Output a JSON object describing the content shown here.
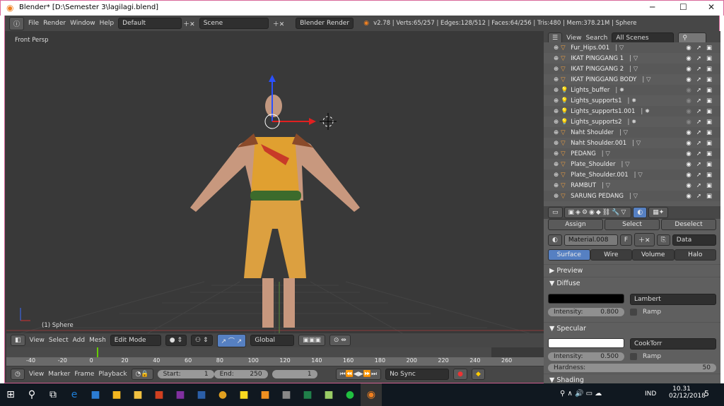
{
  "window": {
    "title": "Blender* [D:\\Semester 3\\lagilagi.blend]",
    "minimize": "─",
    "maximize": "☐",
    "close": "✕"
  },
  "info_header": {
    "menus": [
      "File",
      "Render",
      "Window",
      "Help"
    ],
    "layout": "Default",
    "scene": "Scene",
    "engine": "Blender Render",
    "stats": "v2.78 | Verts:65/257 | Edges:128/512 | Faces:64/256 | Tris:480 | Mem:378.21M | Sphere"
  },
  "viewport": {
    "view_label": "Front Persp",
    "object_label": "(1) Sphere"
  },
  "view3d_header": {
    "menus": [
      "View",
      "Select",
      "Add",
      "Mesh"
    ],
    "mode": "Edit Mode",
    "orientation": "Global"
  },
  "timeline": {
    "ruler": [
      "-40",
      "-20",
      "0",
      "20",
      "40",
      "60",
      "80",
      "100",
      "120",
      "140",
      "160",
      "180",
      "200",
      "220",
      "240",
      "260"
    ],
    "menus": [
      "View",
      "Marker",
      "Frame",
      "Playback"
    ],
    "start_label": "Start:",
    "start": "1",
    "end_label": "End:",
    "end": "250",
    "current": "1",
    "sync": "No Sync"
  },
  "outliner": {
    "menus": [
      "View",
      "Search"
    ],
    "filter": "All Scenes",
    "items": [
      {
        "name": "Fur_Hips.001",
        "type": "mesh"
      },
      {
        "name": "IKAT PINGGANG 1",
        "type": "mesh"
      },
      {
        "name": "IKAT PINGGANG 2",
        "type": "mesh"
      },
      {
        "name": "IKAT PINGGANG BODY",
        "type": "mesh"
      },
      {
        "name": "Lights_buffer",
        "type": "light"
      },
      {
        "name": "Lights_supports1",
        "type": "light"
      },
      {
        "name": "Lights_supports1.001",
        "type": "light"
      },
      {
        "name": "Lights_supports2",
        "type": "light"
      },
      {
        "name": "Naht Shoulder",
        "type": "mesh"
      },
      {
        "name": "Naht Shoulder.001",
        "type": "mesh"
      },
      {
        "name": "PEDANG",
        "type": "mesh"
      },
      {
        "name": "Plate_Shoulder",
        "type": "mesh"
      },
      {
        "name": "Plate_Shoulder.001",
        "type": "mesh"
      },
      {
        "name": "RAMBUT",
        "type": "mesh"
      },
      {
        "name": "SARUNG PEDANG",
        "type": "mesh"
      }
    ]
  },
  "properties": {
    "assign": "Assign",
    "select": "Select",
    "deselect": "Deselect",
    "material": "Material.008",
    "fake_user": "F",
    "link": "Data",
    "tabs": [
      "Surface",
      "Wire",
      "Volume",
      "Halo"
    ],
    "preview": "Preview",
    "diffuse": {
      "title": "Diffuse",
      "shader": "Lambert",
      "intensity_label": "Intensity:",
      "intensity": "0.800",
      "ramp": "Ramp",
      "color": "#000000"
    },
    "specular": {
      "title": "Specular",
      "shader": "CookTorr",
      "intensity_label": "Intensity:",
      "intensity": "0.500",
      "ramp": "Ramp",
      "color": "#ffffff",
      "hardness_label": "Hardness:",
      "hardness": "50"
    },
    "shading": "Shading"
  },
  "taskbar": {
    "lang": "IND",
    "time": "10.31",
    "date": "02/12/2018",
    "notifications": "5"
  },
  "colors": {
    "accent": "#5680c2",
    "orange": "#f0a040"
  }
}
